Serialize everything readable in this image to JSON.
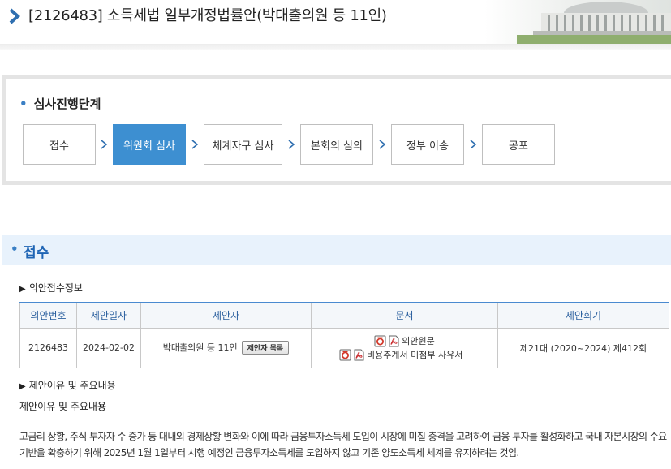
{
  "header": {
    "title": "[2126483] 소득세법 일부개정법률안(박대출의원 등 11인)"
  },
  "stage_section": {
    "heading": "심사진행단계",
    "stages": [
      {
        "label": "접수",
        "active": false
      },
      {
        "label": "위원회 심사",
        "active": true
      },
      {
        "label": "체계자구 심사",
        "active": false
      },
      {
        "label": "본회의 심의",
        "active": false
      },
      {
        "label": "정부 이송",
        "active": false
      },
      {
        "label": "공포",
        "active": false
      }
    ]
  },
  "receipt_section": {
    "title": "접수",
    "info_heading": "의안접수정보",
    "table": {
      "headers": [
        "의안번호",
        "제안일자",
        "제안자",
        "문서",
        "제안회기"
      ],
      "row": {
        "bill_no": "2126483",
        "date": "2024-02-02",
        "proposer": "박대출의원 등 11인",
        "proposer_button": "제안자 목록",
        "documents": [
          "의안원문",
          "비용추계서 미첨부 사유서"
        ],
        "session": "제21대 (2020~2024) 제412회"
      }
    },
    "reason_heading": "제안이유 및 주요내용",
    "reason_label": "제안이유 및 주요내용",
    "reason_text": "고금리 상황, 주식 투자자 수 증가 등 대내외 경제상황 변화와 이에 따라 금융투자소득세 도입이 시장에 미칠 충격을 고려하여 금융 투자를 활성화하고 국내 자본시장의 수요기반을 확충하기 위해 2025년 1월 1일부터 시행 예정인 금융투자소득세를 도입하지 않고 기존 양도소득세 체계를 유지하려는 것임."
  },
  "colors": {
    "accent": "#3d8fd1",
    "section_title": "#1e64b4",
    "section_bar": "#e8f2fc",
    "table_header_text": "#2a5f9e"
  },
  "icons": {
    "header": "chevron-right-icon",
    "stage_separator": "chevron-right-icon",
    "document": [
      "hwp-file-icon",
      "pdf-file-icon"
    ]
  }
}
